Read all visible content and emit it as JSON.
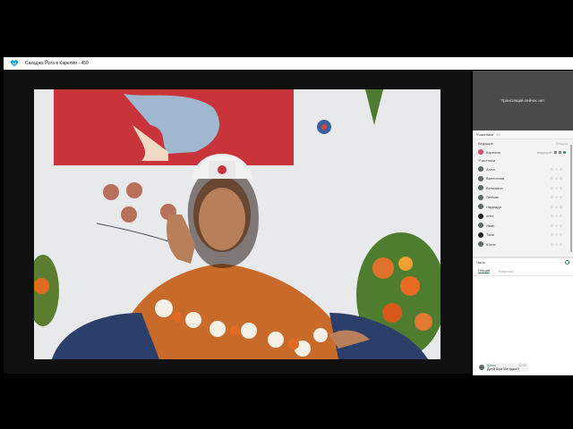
{
  "window": {
    "title": "Сахаджа Йога в Карелии - 450"
  },
  "colors": {
    "accent": "#2e8b57",
    "panel_dark": "#4a4a4a"
  },
  "broadcast": {
    "status": "Трансляций сейчас нет"
  },
  "participants": {
    "header": "Участники",
    "count": "10",
    "hosts_label": "Ведущие",
    "hosts_aux": "Лекции",
    "hosts": [
      {
        "name": "Карелия",
        "tag": "ведущий"
      }
    ],
    "members_label": "Участники",
    "members": [
      {
        "name": "Алла"
      },
      {
        "name": "Валентина"
      },
      {
        "name": "Вениамин"
      },
      {
        "name": "Любовь"
      },
      {
        "name": "Надежда"
      },
      {
        "name": "олег"
      },
      {
        "name": "Иван"
      },
      {
        "name": "Таня"
      },
      {
        "name": "Юлия"
      }
    ]
  },
  "chats": {
    "header": "Чаты",
    "tabs": [
      {
        "label": "Общий"
      },
      {
        "label": "Вопросы"
      }
    ],
    "messages": [
      {
        "author": "Юлия",
        "time": "12:00",
        "text": "Джей Шри Матаджи!!!"
      }
    ]
  }
}
